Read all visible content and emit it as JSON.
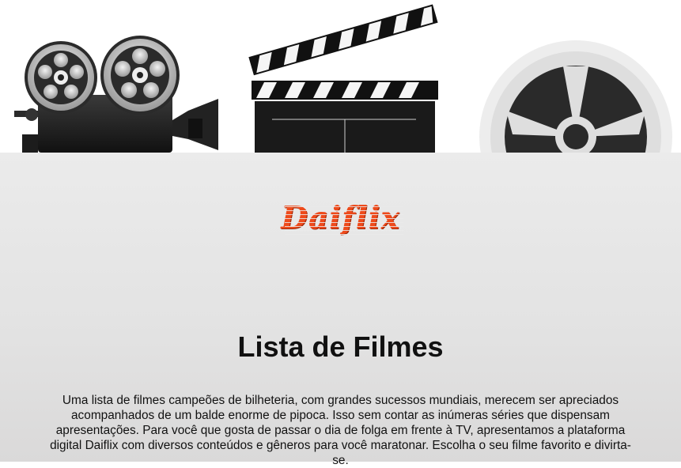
{
  "hero": {
    "icons": [
      "film-projector-icon",
      "clapperboard-icon",
      "film-reel-icon"
    ]
  },
  "brand": {
    "logo_text": "Daiflix",
    "logo_color": "#ee4a1b"
  },
  "main": {
    "title": "Lista de Filmes",
    "description": "Uma lista de filmes campeões de bilheteria, com grandes sucessos mundiais, merecem ser apreciados acompanhados de um balde enorme de pipoca. Isso sem contar as inúmeras séries que dispensam apresentações. Para você que gosta de passar o dia de folga em frente à TV, apresentamos a plataforma digital Daiflix com diversos conteúdos e gêneros para você maratonar. Escolha o seu filme favorito e divirta-se."
  }
}
